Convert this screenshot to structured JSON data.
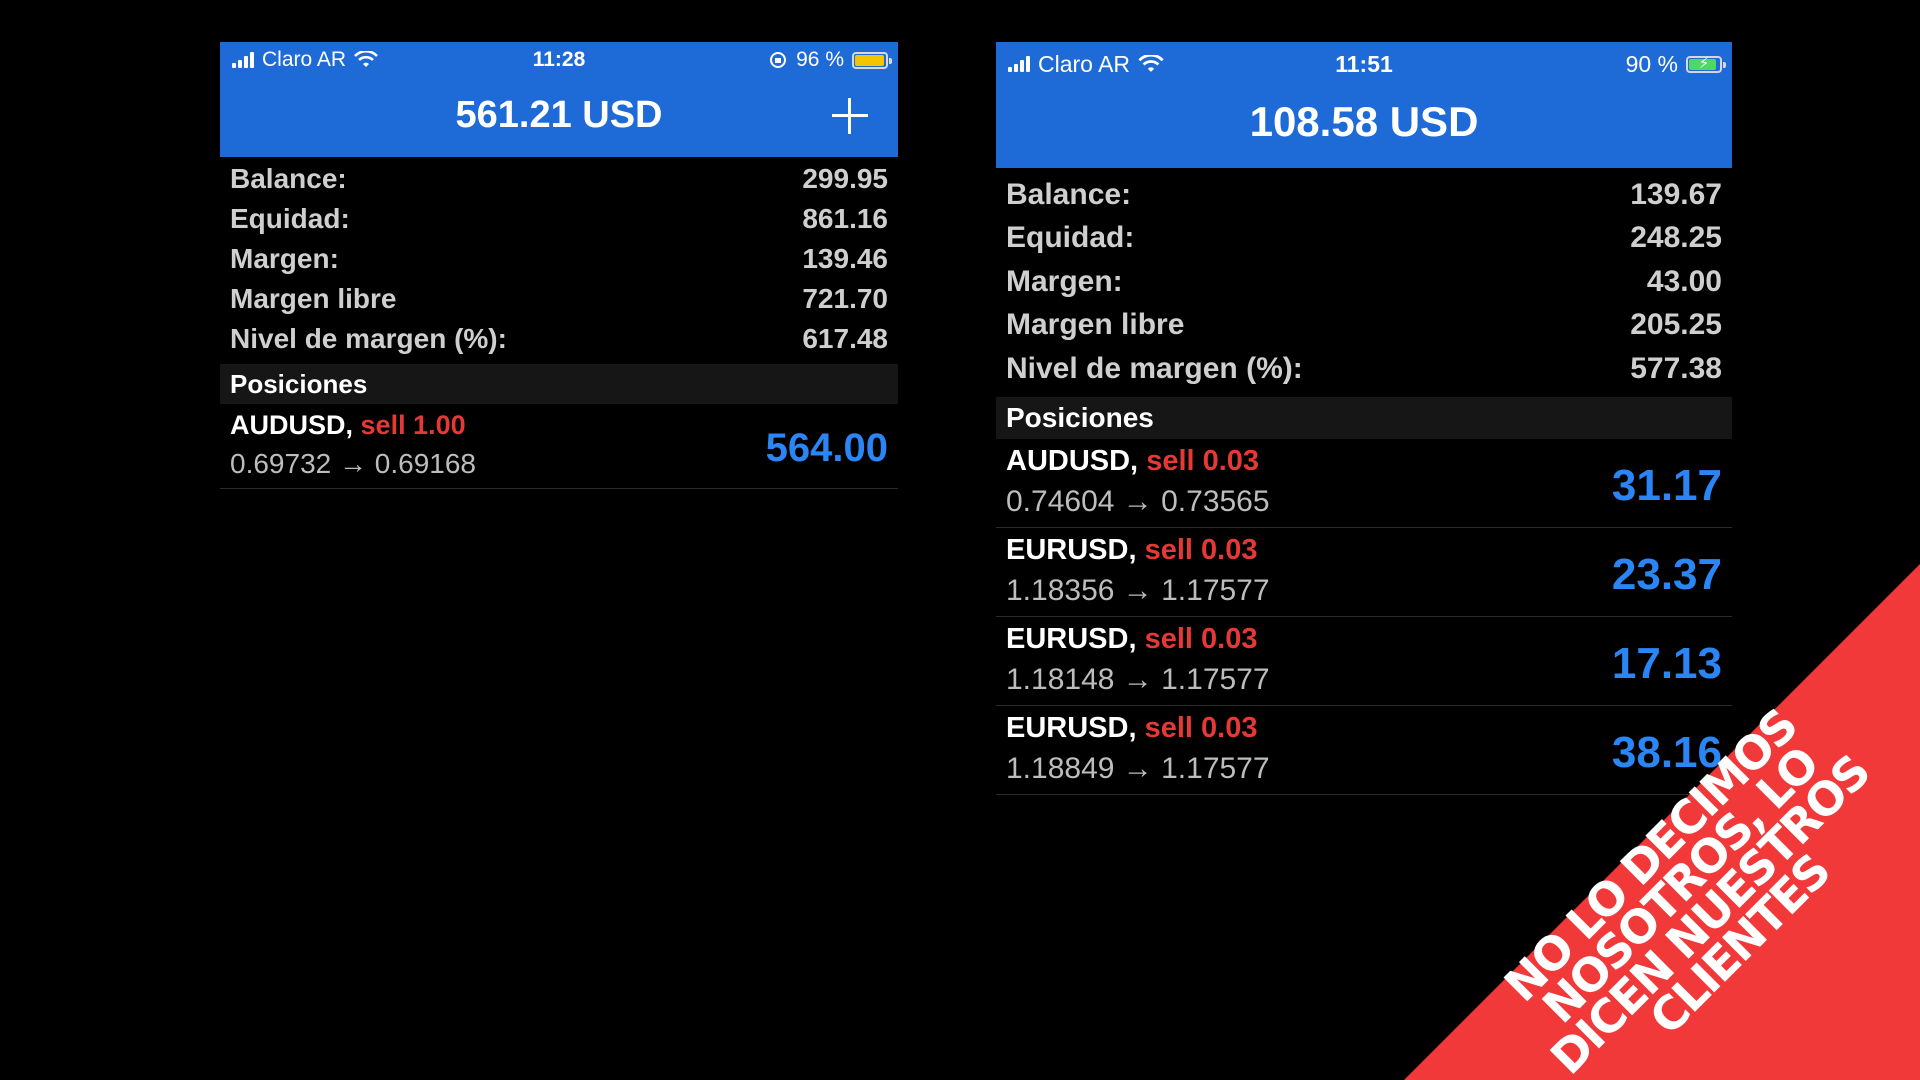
{
  "left_screen": {
    "status_bar": {
      "carrier": "Claro AR",
      "time": "11:28",
      "battery_text": "96 %",
      "battery_level": 0.96,
      "battery_color": "#f5c400"
    },
    "header": {
      "title": "561.21 USD",
      "add_icon": "plus-icon"
    },
    "metrics": [
      {
        "label": "Balance:",
        "value": "299.95"
      },
      {
        "label": "Equidad:",
        "value": "861.16"
      },
      {
        "label": "Margen:",
        "value": "139.46"
      },
      {
        "label": "Margen libre",
        "value": "721.70"
      },
      {
        "label": "Nivel de margen (%):",
        "value": "617.48"
      }
    ],
    "positions_title": "Posiciones",
    "positions": [
      {
        "symbol": "AUDUSD,",
        "type": "sell 1.00",
        "prices": "0.69732 → 0.69168",
        "profit": "564.00"
      }
    ]
  },
  "right_screen": {
    "status_bar": {
      "carrier": "Claro AR",
      "time": "11:51",
      "battery_text": "90 %",
      "battery_level": 0.9,
      "battery_color": "#4cd964"
    },
    "header": {
      "title": "108.58 USD"
    },
    "metrics": [
      {
        "label": "Balance:",
        "value": "139.67"
      },
      {
        "label": "Equidad:",
        "value": "248.25"
      },
      {
        "label": "Margen:",
        "value": "43.00"
      },
      {
        "label": "Margen libre",
        "value": "205.25"
      },
      {
        "label": "Nivel de margen (%):",
        "value": "577.38"
      }
    ],
    "positions_title": "Posiciones",
    "positions": [
      {
        "symbol": "AUDUSD,",
        "type": "sell 0.03",
        "prices": "0.74604 → 0.73565",
        "profit": "31.17"
      },
      {
        "symbol": "EURUSD,",
        "type": "sell 0.03",
        "prices": "1.18356 → 1.17577",
        "profit": "23.37"
      },
      {
        "symbol": "EURUSD,",
        "type": "sell 0.03",
        "prices": "1.18148 → 1.17577",
        "profit": "17.13"
      },
      {
        "symbol": "EURUSD,",
        "type": "sell 0.03",
        "prices": "1.18849 → 1.17577",
        "profit": "38.16"
      }
    ]
  },
  "banner": {
    "lines": [
      "NO LO DECIMOS",
      "NOSOTROS, LO",
      "DICEN NUESTROS",
      "CLIENTES"
    ],
    "color": "#f2393a"
  },
  "colors": {
    "header_blue": "#1e6bd8",
    "profit_blue": "#2a86f5",
    "sell_red": "#e53935"
  }
}
